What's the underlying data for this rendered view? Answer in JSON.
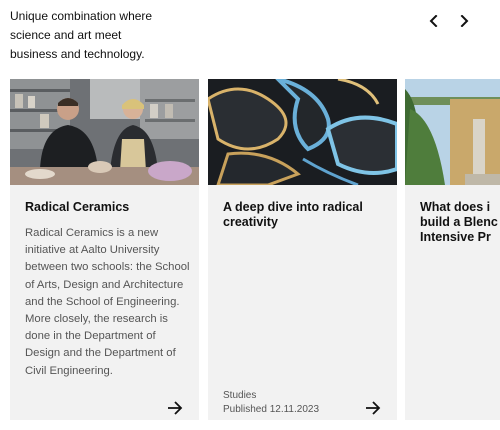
{
  "intro": {
    "line1": "Unique combination where",
    "line2": "science and art meet",
    "line3": "business and technology."
  },
  "nav": {
    "prev_icon": "chevron-left-icon",
    "next_icon": "chevron-right-icon"
  },
  "cards": [
    {
      "title": "Radical Ceramics",
      "description": "Radical Ceramics is a new initiative at Aalto University between two schools: the School of Arts, Design and Architecture and the School of Engineering. More closely, the research is done in the Department of Design and the Department of Civil Engineering.",
      "category": "",
      "published": ""
    },
    {
      "title": "A deep dive into radical creativity",
      "description": "",
      "category": "Studies",
      "published": "Published 12.11.2023"
    },
    {
      "title_lines": [
        "What does i",
        "build a Blenc",
        "Intensive Pr"
      ]
    }
  ],
  "colors": {
    "card_bg": "#f2f2f2",
    "text": "#111111",
    "muted": "#555555"
  }
}
